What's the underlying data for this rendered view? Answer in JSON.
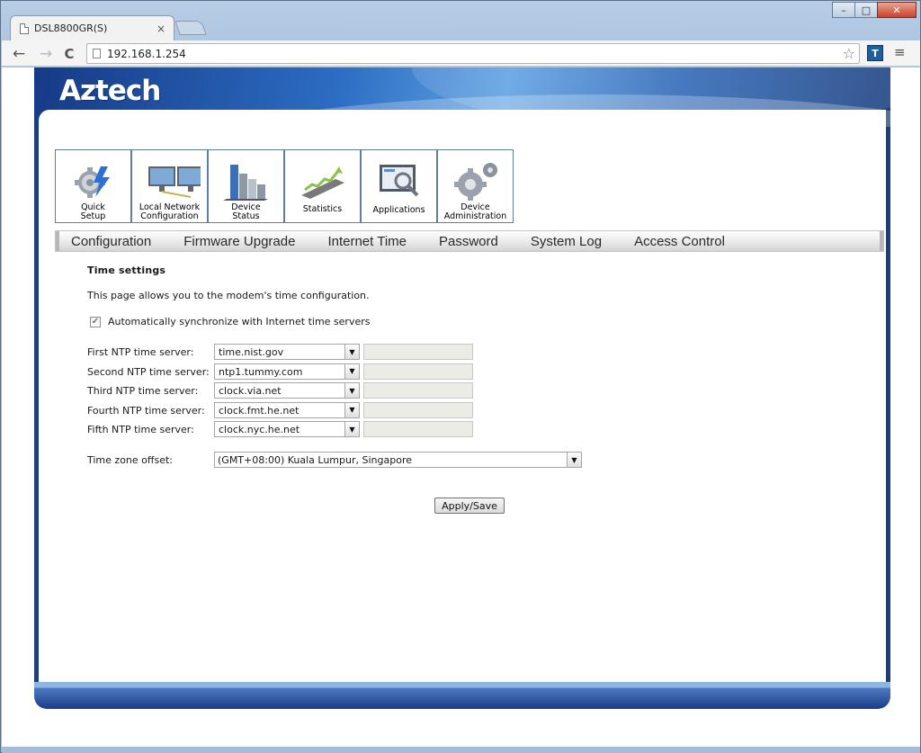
{
  "browser": {
    "tab_title": "DSL8800GR(S)",
    "tab_close": "×",
    "url": "192.168.1.254",
    "minimize": "–",
    "maximize": "□",
    "close": "✕",
    "back": "←",
    "forward": "→",
    "reload": "C",
    "star": "☆",
    "menu": "≡",
    "ext_letter": "T"
  },
  "router": {
    "logo": "Aztech",
    "icons": [
      {
        "label_line1": "Quick",
        "label_line2": "Setup"
      },
      {
        "label_line1": "Local  Network",
        "label_line2": "Configuration"
      },
      {
        "label_line1": "Device",
        "label_line2": "Status"
      },
      {
        "label_line1": "Statistics",
        "label_line2": ""
      },
      {
        "label_line1": "Applications",
        "label_line2": ""
      },
      {
        "label_line1": "Device",
        "label_line2": "Administration"
      }
    ],
    "nav": [
      "Configuration",
      "Firmware Upgrade",
      "Internet Time",
      "Password",
      "System Log",
      "Access Control"
    ]
  },
  "page": {
    "title": "Time settings",
    "description": "This page allows you to the modem's time configuration.",
    "sync_checked": true,
    "sync_label": "Automatically synchronize with Internet time servers",
    "ntp": [
      {
        "label": "First NTP time server:",
        "value": "time.nist.gov"
      },
      {
        "label": "Second NTP time server:",
        "value": "ntp1.tummy.com"
      },
      {
        "label": "Third NTP time server:",
        "value": "clock.via.net"
      },
      {
        "label": "Fourth NTP time server:",
        "value": "clock.fmt.he.net"
      },
      {
        "label": "Fifth NTP time server:",
        "value": "clock.nyc.he.net"
      }
    ],
    "tz_label": "Time zone offset:",
    "tz_value": "(GMT+08:00) Kuala Lumpur, Singapore",
    "apply_label": "Apply/Save",
    "checkmark": "✓",
    "dropdown_arrow": "▼"
  }
}
